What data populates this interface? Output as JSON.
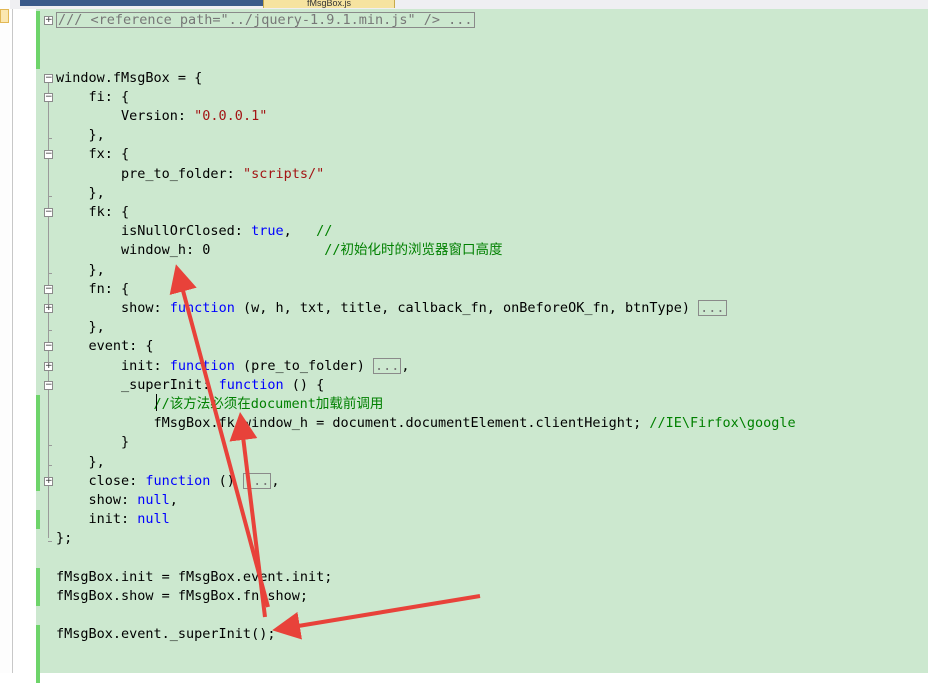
{
  "tab": {
    "title": "fMsgBox.js",
    "active": true
  },
  "code": [
    {
      "type": "box",
      "text": "/// <reference path=\"../jquery-1.9.1.min.js\" /> ..."
    },
    {
      "type": "blank"
    },
    {
      "type": "blank"
    },
    {
      "type": "text",
      "text": "window.fMsgBox = {"
    },
    {
      "type": "mixed",
      "parts": [
        {
          "t": "    fi: {"
        }
      ]
    },
    {
      "type": "mixed",
      "parts": [
        {
          "t": "        Version: "
        },
        {
          "t": "\"0.0.0.1\"",
          "c": "str"
        }
      ]
    },
    {
      "type": "text",
      "text": "    },"
    },
    {
      "type": "text",
      "text": "    fx: {"
    },
    {
      "type": "mixed",
      "parts": [
        {
          "t": "        pre_to_folder: "
        },
        {
          "t": "\"scripts/\"",
          "c": "str"
        }
      ]
    },
    {
      "type": "text",
      "text": "    },"
    },
    {
      "type": "text",
      "text": "    fk: {"
    },
    {
      "type": "mixed",
      "parts": [
        {
          "t": "        isNullOrClosed: "
        },
        {
          "t": "true",
          "c": "kw"
        },
        {
          "t": ",   "
        },
        {
          "t": "//",
          "c": "cmt"
        }
      ]
    },
    {
      "type": "mixed",
      "parts": [
        {
          "t": "        window_h: 0              "
        },
        {
          "t": "//初始化时的浏览器窗口高度",
          "c": "cmt"
        }
      ]
    },
    {
      "type": "text",
      "text": "    },"
    },
    {
      "type": "text",
      "text": "    fn: {"
    },
    {
      "type": "mixed",
      "parts": [
        {
          "t": "        show: "
        },
        {
          "t": "function",
          "c": "kw"
        },
        {
          "t": " (w, h, txt, title, callback_fn, onBeforeOK_fn, btnType) "
        },
        {
          "t": "...",
          "c": "box"
        }
      ]
    },
    {
      "type": "text",
      "text": "    },"
    },
    {
      "type": "text",
      "text": "    event: {"
    },
    {
      "type": "mixed",
      "parts": [
        {
          "t": "        init: "
        },
        {
          "t": "function",
          "c": "kw"
        },
        {
          "t": " (pre_to_folder) "
        },
        {
          "t": "...",
          "c": "box"
        },
        {
          "t": ","
        }
      ]
    },
    {
      "type": "mixed",
      "parts": [
        {
          "t": "        _superInit: "
        },
        {
          "t": "function",
          "c": "kw"
        },
        {
          "t": " () {"
        }
      ]
    },
    {
      "type": "mixed",
      "parts": [
        {
          "t": "            "
        },
        {
          "t": "//该方法必须在document加载前调用",
          "c": "cmt"
        }
      ]
    },
    {
      "type": "mixed",
      "parts": [
        {
          "t": "            fMsgBox.fk.window_h = document.documentElement.clientHeight; "
        },
        {
          "t": "//IE\\Firfox\\google",
          "c": "cmt"
        }
      ]
    },
    {
      "type": "text",
      "text": "        }"
    },
    {
      "type": "text",
      "text": "    },"
    },
    {
      "type": "mixed",
      "parts": [
        {
          "t": "    close: "
        },
        {
          "t": "function",
          "c": "kw"
        },
        {
          "t": " () "
        },
        {
          "t": "...",
          "c": "box"
        },
        {
          "t": ","
        }
      ]
    },
    {
      "type": "mixed",
      "parts": [
        {
          "t": "    show: "
        },
        {
          "t": "null",
          "c": "kw"
        },
        {
          "t": ","
        }
      ]
    },
    {
      "type": "mixed",
      "parts": [
        {
          "t": "    init: "
        },
        {
          "t": "null",
          "c": "kw"
        }
      ]
    },
    {
      "type": "text",
      "text": "};"
    },
    {
      "type": "blank"
    },
    {
      "type": "text",
      "text": "fMsgBox.init = fMsgBox.event.init;"
    },
    {
      "type": "text",
      "text": "fMsgBox.show = fMsgBox.fn.show;"
    },
    {
      "type": "blank"
    },
    {
      "type": "text",
      "text": "fMsgBox.event._superInit();"
    }
  ],
  "colors": {
    "editor_background": "#cce8cf",
    "keyword": "#0000ff",
    "string": "#a31515",
    "comment": "#008000",
    "change_bar": "#6ed46a",
    "annotation_arrow": "#e8423a"
  },
  "icons": [
    "fold-expand-icon",
    "fold-collapse-icon",
    "red-annotation-arrow"
  ]
}
